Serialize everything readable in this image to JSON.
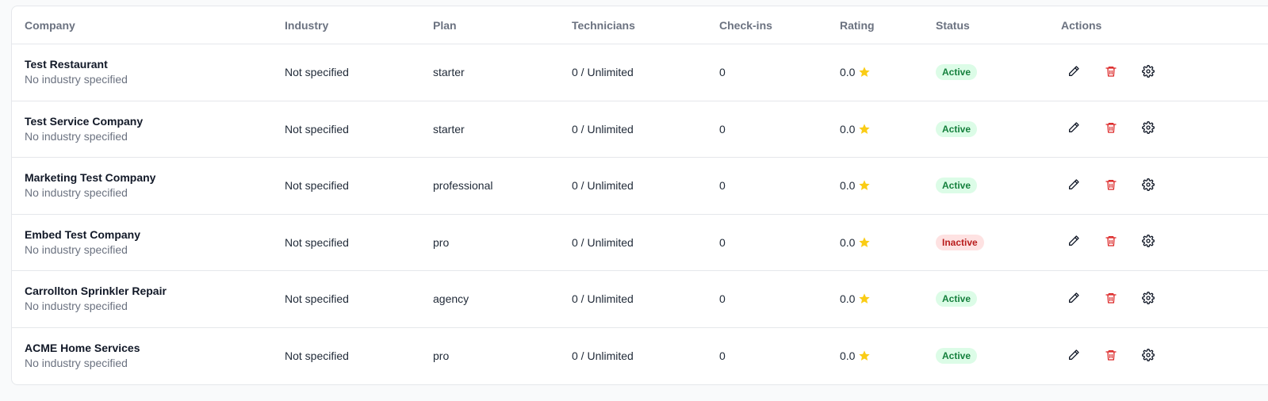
{
  "table": {
    "headers": {
      "company": "Company",
      "industry": "Industry",
      "plan": "Plan",
      "technicians": "Technicians",
      "checkins": "Check-ins",
      "rating": "Rating",
      "status": "Status",
      "actions": "Actions"
    },
    "rows": [
      {
        "name": "Test Restaurant",
        "sub": "No industry specified",
        "industry": "Not specified",
        "plan": "starter",
        "technicians": "0 / Unlimited",
        "checkins": "0",
        "rating": "0.0",
        "status": "Active"
      },
      {
        "name": "Test Service Company",
        "sub": "No industry specified",
        "industry": "Not specified",
        "plan": "starter",
        "technicians": "0 / Unlimited",
        "checkins": "0",
        "rating": "0.0",
        "status": "Active"
      },
      {
        "name": "Marketing Test Company",
        "sub": "No industry specified",
        "industry": "Not specified",
        "plan": "professional",
        "technicians": "0 / Unlimited",
        "checkins": "0",
        "rating": "0.0",
        "status": "Active"
      },
      {
        "name": "Embed Test Company",
        "sub": "No industry specified",
        "industry": "Not specified",
        "plan": "pro",
        "technicians": "0 / Unlimited",
        "checkins": "0",
        "rating": "0.0",
        "status": "Inactive"
      },
      {
        "name": "Carrollton Sprinkler Repair",
        "sub": "No industry specified",
        "industry": "Not specified",
        "plan": "agency",
        "technicians": "0 / Unlimited",
        "checkins": "0",
        "rating": "0.0",
        "status": "Active"
      },
      {
        "name": "ACME Home Services",
        "sub": "No industry specified",
        "industry": "Not specified",
        "plan": "pro",
        "technicians": "0 / Unlimited",
        "checkins": "0",
        "rating": "0.0",
        "status": "Active"
      }
    ]
  },
  "icons": {
    "rating": "star-icon",
    "edit": "pencil-icon",
    "delete": "trash-icon",
    "settings": "gear-icon"
  },
  "colors": {
    "star": "#facc15",
    "delete": "#dc2626",
    "active_bg": "#dcfce7",
    "active_text": "#15803d",
    "inactive_bg": "#fee2e2",
    "inactive_text": "#b91c1c"
  }
}
